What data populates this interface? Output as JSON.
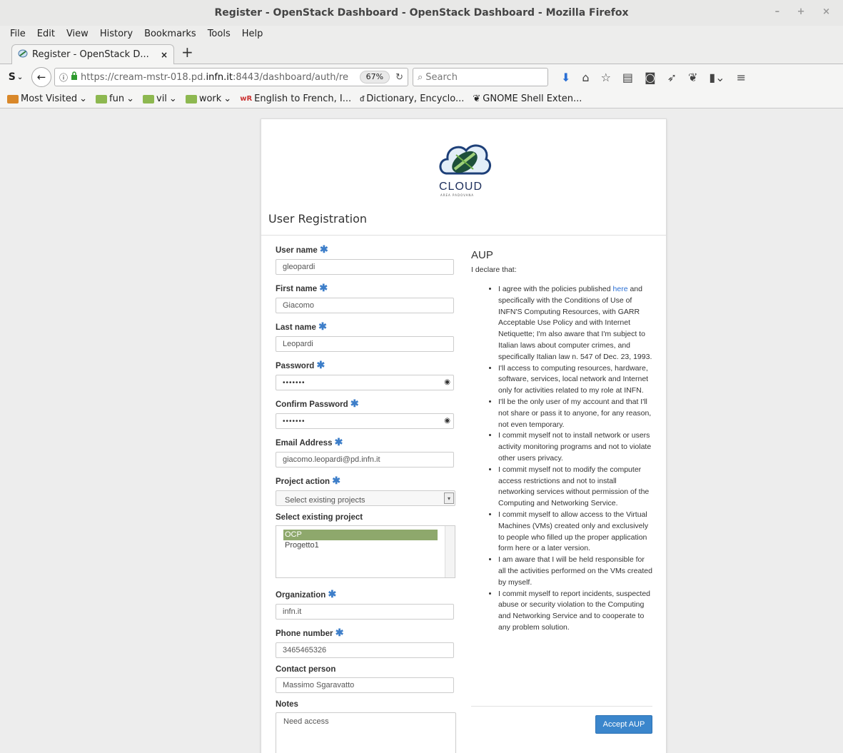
{
  "window": {
    "title": "Register - OpenStack Dashboard - OpenStack Dashboard - Mozilla Firefox",
    "controls": "– + ×"
  },
  "menu": [
    "File",
    "Edit",
    "View",
    "History",
    "Bookmarks",
    "Tools",
    "Help"
  ],
  "tab": {
    "title": "Register - OpenStack D...",
    "close": "×",
    "new_tab": "+"
  },
  "navbar": {
    "url_prefix": "https://cream-mstr-018.pd.",
    "url_domain": "infn.it",
    "url_suffix": ":8443/dashboard/auth/re",
    "zoom": "67%",
    "search_placeholder": "Search"
  },
  "bookmarks": [
    "Most Visited",
    "fun",
    "vil",
    "work",
    "English to French, I...",
    "Dictionary, Encyclo...",
    "GNOME Shell Exten..."
  ],
  "logo": {
    "text": "CLOUD",
    "subtext": "AREA PADOVANA"
  },
  "form": {
    "heading": "User Registration",
    "required_mark": "✱",
    "username": {
      "label": "User name",
      "value": "gleopardi"
    },
    "first_name": {
      "label": "First name",
      "value": "Giacomo"
    },
    "last_name": {
      "label": "Last name",
      "value": "Leopardi"
    },
    "password": {
      "label": "Password",
      "value": "•••••••"
    },
    "confirm_password": {
      "label": "Confirm Password",
      "value": "•••••••"
    },
    "email": {
      "label": "Email Address",
      "value": "giacomo.leopardi@pd.infn.it"
    },
    "project_action": {
      "label": "Project action",
      "value": "Select existing projects"
    },
    "select_project": {
      "label": "Select existing project",
      "options": [
        "OCP",
        "Progetto1"
      ],
      "selected": "OCP"
    },
    "organization": {
      "label": "Organization",
      "value": "infn.it"
    },
    "phone": {
      "label": "Phone number",
      "value": "3465465326"
    },
    "contact": {
      "label": "Contact person",
      "value": "Massimo Sgaravatto"
    },
    "notes": {
      "label": "Notes",
      "value": "Need access"
    }
  },
  "aup": {
    "title": "AUP",
    "intro": "I declare that:",
    "item1_before_link": "I agree with the policies published ",
    "item1_link": "here",
    "item1_after_link": " and specifically with the Conditions of Use of INFN'S Computing Resources, with GARR Acceptable Use Policy and with Internet Netiquette; I'm also aware that I'm subject to Italian laws about computer crimes, and specifically Italian law n. 547 of Dec. 23, 1993.",
    "items": [
      "I'll access to computing resources, hardware, software, services, local network and Internet only for activities related to my role at INFN.",
      "I'll be the only user of my account and that I'll not share or pass it to anyone, for any reason, not even temporary.",
      "I commit myself not to install network or users activity monitoring programs and not to violate other users privacy.",
      "I commit myself not to modify the computer access restrictions and not to install networking services without permission of the Computing and Networking Service.",
      "I commit myself to allow access to the Virtual Machines (VMs) created only and exclusively to people who filled up the proper application form here or a later version.",
      "I am aware that I will be held responsible for all the activities performed on the VMs created by myself.",
      "I commit myself to report incidents, suspected abuse or security violation to the Computing and Networking Service and to cooperate to any problem solution."
    ],
    "accept_label": "Accept AUP"
  }
}
